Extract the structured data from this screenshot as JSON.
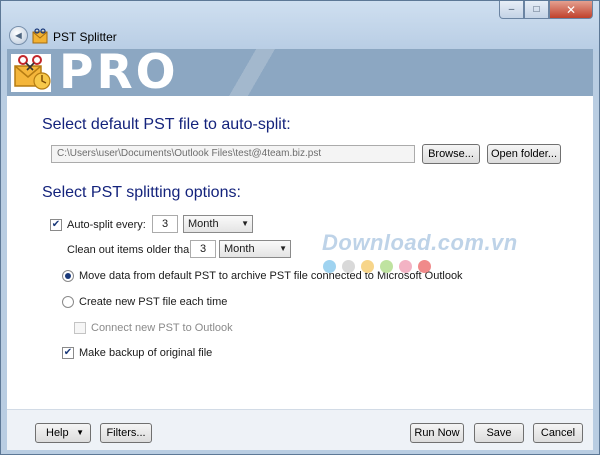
{
  "window": {
    "title": "PST Splitter",
    "minimize_glyph": "–",
    "maximize_glyph": "□",
    "close_glyph": "✕",
    "back_glyph": "◄"
  },
  "banner": {
    "text": "PRO"
  },
  "file_section": {
    "heading": "Select default PST file to auto-split:",
    "path_value": "C:\\Users\\user\\Documents\\Outlook Files\\test@4team.biz.pst",
    "browse_label": "Browse...",
    "open_folder_label": "Open folder..."
  },
  "options_section": {
    "heading": "Select PST splitting options:",
    "auto_split": {
      "label": "Auto-split every:",
      "checked": true,
      "value": "3",
      "unit": "Month"
    },
    "clean_out": {
      "label": "Clean out items older than",
      "value": "3",
      "unit": "Month"
    },
    "move_radio": {
      "label": "Move data from default PST to archive PST file connected to Microsoft Outlook",
      "selected": true
    },
    "create_radio": {
      "label": "Create new PST file each time",
      "selected": false
    },
    "connect_check": {
      "label": "Connect new PST to Outlook",
      "checked": false,
      "disabled": true
    },
    "backup_check": {
      "label": "Make backup of original file",
      "checked": true
    }
  },
  "watermark": {
    "text": "Download.com.vn",
    "dot_colors": [
      "#9fd3f0",
      "#d9d9d9",
      "#f7d58a",
      "#bfe3a0",
      "#f3b3c4",
      "#f08a8a"
    ]
  },
  "footer": {
    "help_label": "Help",
    "filters_label": "Filters...",
    "run_now_label": "Run Now",
    "save_label": "Save",
    "cancel_label": "Cancel"
  },
  "colors": {
    "heading": "#14237c",
    "banner": "#8ca7c2",
    "titlebar": "#b8cde4"
  },
  "icons": {
    "app": "scissors-envelope-icon",
    "back": "back-arrow-icon",
    "dropdown": "chevron-down-icon"
  }
}
